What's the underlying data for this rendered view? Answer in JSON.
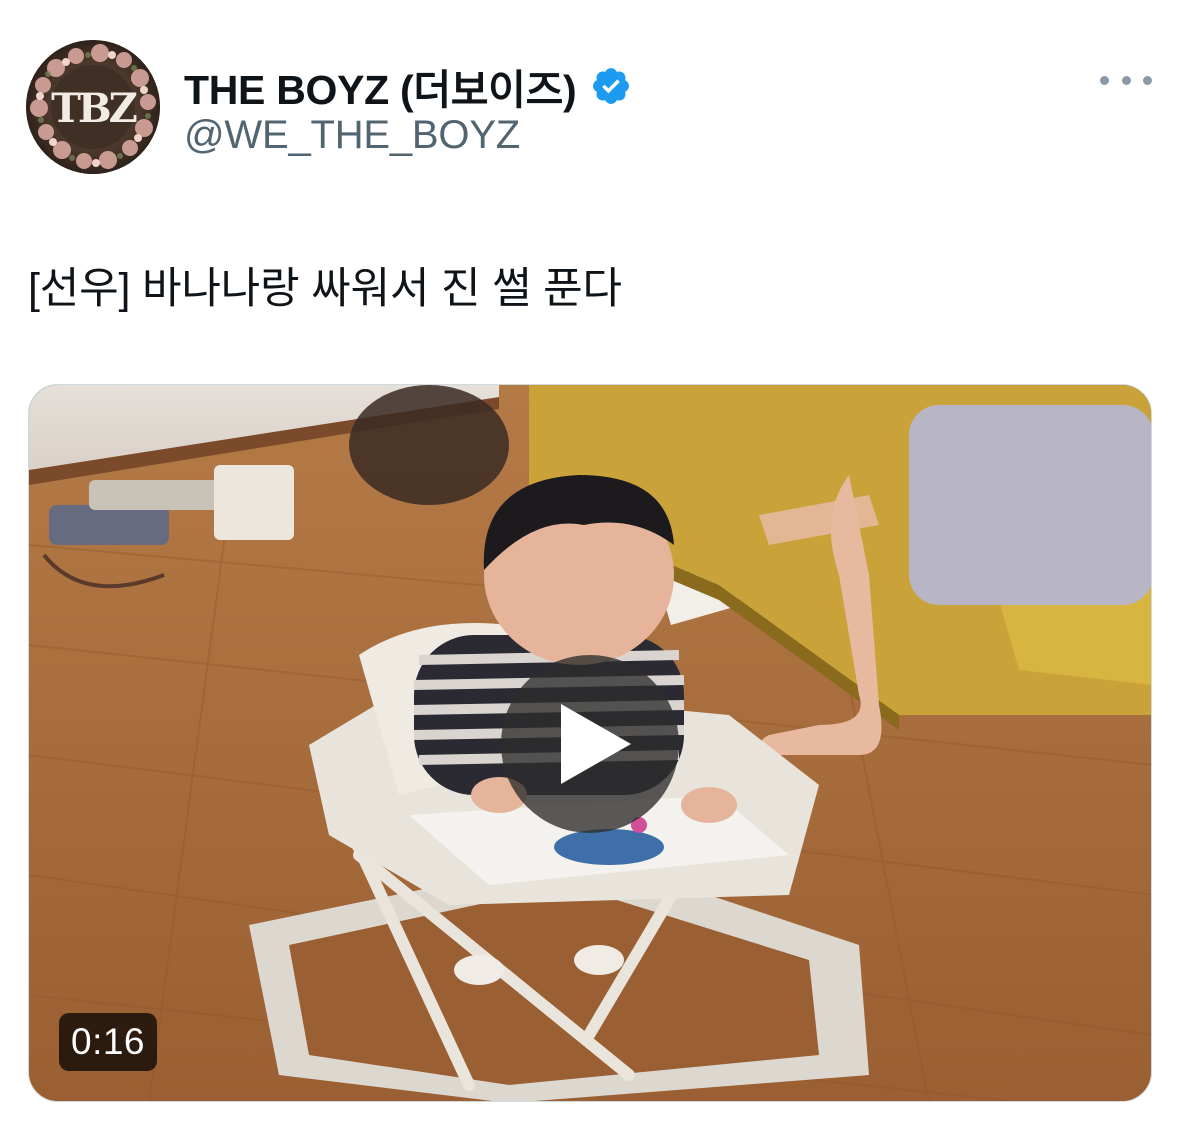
{
  "author": {
    "display_name": "THE BOYZ (더보이즈)",
    "handle": "@WE_THE_BOYZ",
    "verified": true,
    "avatar_logo": "TBZ"
  },
  "tweet": {
    "text": "[선우] 바나나랑 싸워서 진 썰 푼다"
  },
  "media": {
    "type": "video",
    "duration": "0:16",
    "icons": {
      "play": "play-icon",
      "more": "more-icon",
      "verified": "verified-badge-icon"
    }
  },
  "colors": {
    "verified_blue": "#1d9bf0",
    "secondary_text": "#536471",
    "primary_text": "#0f1419"
  }
}
